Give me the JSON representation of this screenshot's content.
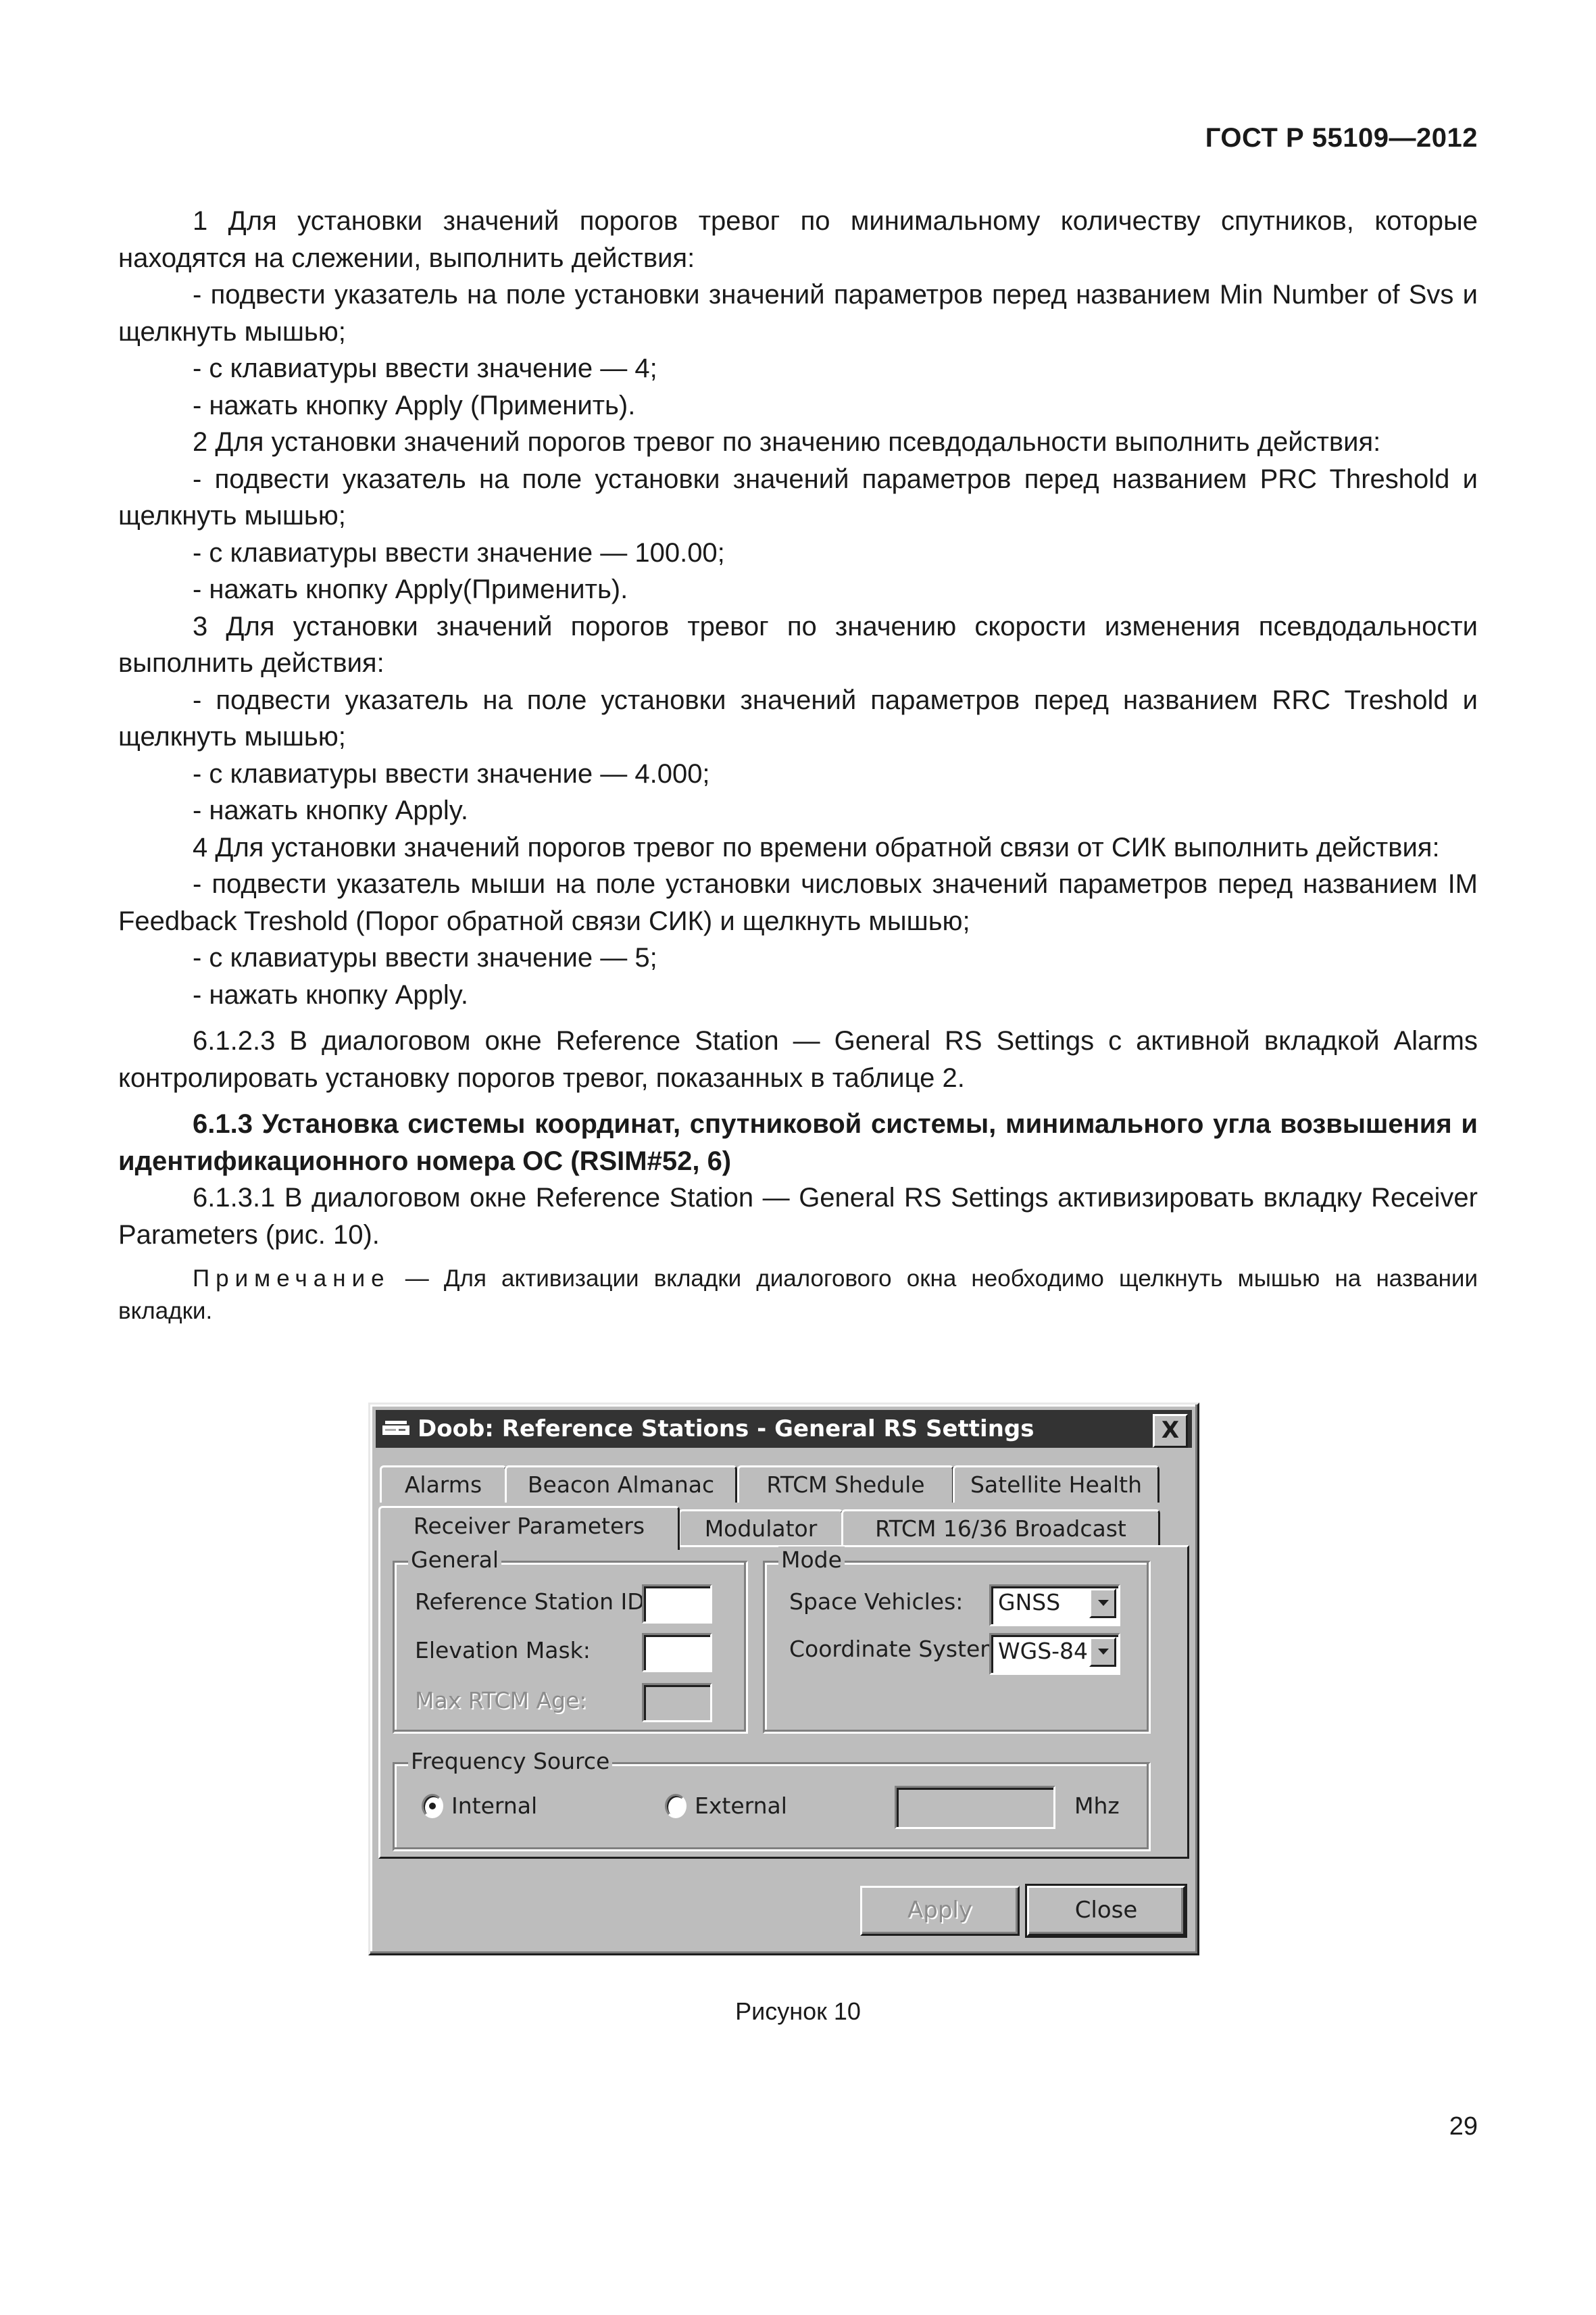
{
  "header": {
    "doc_id": "ГОСТ Р 55109—2012"
  },
  "paragraphs": [
    {
      "text": "1 Для установки значений порогов тревог по минимальному количеству спутников, которые находятся на слежении, выполнить действия:",
      "style": "ind"
    },
    {
      "text": "- подвести указатель на поле установки значений параметров перед названием Min Number of Svs и щелкнуть мышью;",
      "style": "ind"
    },
    {
      "text": "- с клавиатуры ввести значение — 4;",
      "style": "ind"
    },
    {
      "text": "- нажать кнопку Apply (Применить).",
      "style": "ind"
    },
    {
      "text": "2 Для установки значений порогов тревог по значению псевдодальности выполнить действия:",
      "style": "ind"
    },
    {
      "text": "- подвести указатель на поле установки значений параметров перед названием PRC Threshold и щелкнуть мышью;",
      "style": "ind"
    },
    {
      "text": "- с клавиатуры ввести значение — 100.00;",
      "style": "ind"
    },
    {
      "text": "- нажать кнопку Apply(Применить).",
      "style": "ind"
    },
    {
      "text": "3 Для установки значений порогов тревог по значению скорости изменения псевдодальности выполнить действия:",
      "style": "ind"
    },
    {
      "text": "- подвести указатель на поле установки значений параметров перед названием RRC Treshold и щелкнуть мышью;",
      "style": "ind"
    },
    {
      "text": "- с клавиатуры ввести значение — 4.000;",
      "style": "ind"
    },
    {
      "text": "- нажать кнопку Apply.",
      "style": "ind"
    },
    {
      "text": "4 Для установки значений порогов тревог по времени обратной связи от СИК выполнить действия:",
      "style": "ind"
    },
    {
      "text": "- подвести указатель мыши на поле установки числовых значений параметров перед названием IM Feedback Treshold (Порог обратной связи СИК) и щелкнуть мышью;",
      "style": "ind"
    },
    {
      "text": "- с клавиатуры ввести значение — 5;",
      "style": "ind"
    },
    {
      "text": "- нажать кнопку Apply.",
      "style": "ind"
    },
    {
      "text": "6.1.2.3 В диалоговом окне Reference Station — General RS Settings с активной вкладкой Alarms контролировать установку порогов тревог, показанных в таблице 2.",
      "style": "ind gap"
    },
    {
      "text": "6.1.3 Установка системы координат, спутниковой системы, минимального угла возвышения и идентификационного номера ОС (RSIM#52, 6)",
      "style": "ind gap bold"
    },
    {
      "text": "6.1.3.1 В диалоговом окне Reference Station — General RS Settings активизировать вкладку Receiver Parameters (рис. 10).",
      "style": "ind"
    }
  ],
  "note": {
    "prefix": "Примечание",
    "text": " — Для активизации вкладки диалогового окна необходимо щелкнуть мышью на названии вкладки."
  },
  "dialog": {
    "title": "Doob: Reference Stations - General RS Settings",
    "close_glyph": "X",
    "tabs_row1": [
      "Alarms",
      "Beacon Almanac",
      "RTCM Shedule",
      "Satellite Health"
    ],
    "tabs_row2": [
      "Receiver Parameters",
      "Modulator",
      "RTCM 16/36 Broadcast"
    ],
    "active_tab": "Receiver Parameters",
    "general": {
      "label": "General",
      "reference_station_id_label": "Reference Station ID:",
      "reference_station_id_value": "",
      "elevation_mask_label": "Elevation Mask:",
      "elevation_mask_value": "",
      "max_rtcm_age_label": "Max RTCM Age:",
      "max_rtcm_age_value": ""
    },
    "mode": {
      "label": "Mode",
      "space_vehicles_label": "Space Vehicles:",
      "space_vehicles_value": "GNSS",
      "coordinate_system_label": "Coordinate System:",
      "coordinate_system_value": "WGS-84"
    },
    "frequency": {
      "label": "Frequency Source",
      "internal_label": "Internal",
      "external_label": "External",
      "selected": "Internal",
      "value": "",
      "unit": "Mhz"
    },
    "buttons": {
      "apply": "Apply",
      "close": "Close"
    }
  },
  "caption": "Рисунок 10",
  "page_number": "29"
}
